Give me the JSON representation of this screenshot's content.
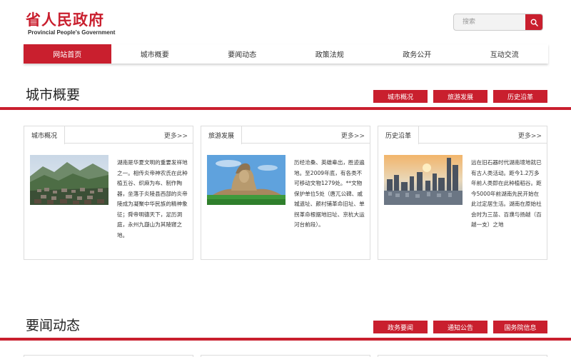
{
  "header": {
    "logo_cn": "省人民政府",
    "logo_en": "Provincial People's Government",
    "search_placeholder": "搜索"
  },
  "nav": {
    "items": [
      "网站首页",
      "城市概要",
      "要闻动态",
      "政策法规",
      "政务公开",
      "互动交流"
    ],
    "active_index": 0
  },
  "section_city": {
    "title": "城市概要",
    "tabs": [
      "城市概况",
      "旅游发展",
      "历史沿革"
    ]
  },
  "cards": [
    {
      "tab": "城市概况",
      "more": "更多>>",
      "text": "湖南是华夏文明的重要发祥地之一。相传炎帝神农氏在此种植五谷、织麻为布、制作陶器，坐落于炎陵县西部的炎帝陵成为凝聚中华民族的精神象征；舜帝明德天下，足历洞庭，永州九嶷山为其陵寝之地。"
    },
    {
      "tab": "旅游发展",
      "more": "更多>>",
      "text": "历经沧桑、英雄辈出，胜迹遍地。至2009年底，有各类不可移动文物1279处。**文物保护单位5处（唐兀公碑、戚城遗址、颜村铺革命旧址、单拐革命根据地旧址、京杭大运河台前段）。"
    },
    {
      "tab": "历史沿革",
      "more": "更多>>",
      "text": "远在旧石器时代湖南境地就已有古人类活动。距今1.2万多年前人类即在此种植稻谷。距今5000年前湖南先民开始在此过定居生活。湖南在原始社会时为三苗、百濮与扬越（百越一支）之地"
    }
  ],
  "section_news": {
    "title": "要闻动态",
    "tabs": [
      "政务要闻",
      "通知公告",
      "国务院信息"
    ]
  },
  "colors": {
    "brand_red": "#c91f2e"
  }
}
